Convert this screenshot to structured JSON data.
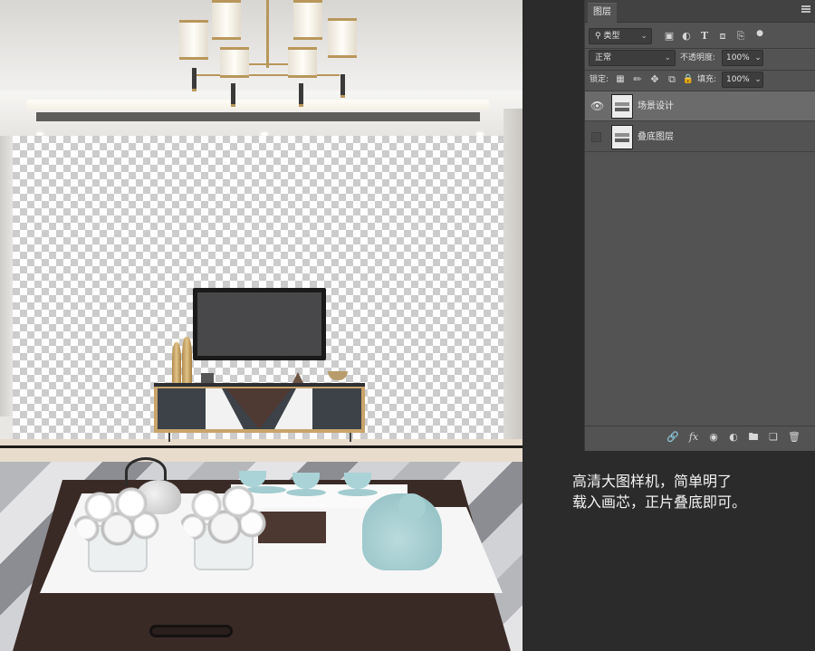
{
  "layers_panel": {
    "tab_title": "图层",
    "filter": {
      "label": "类型",
      "icon": "search-icon"
    },
    "filter_icons": [
      "image-filter-icon",
      "adjustment-filter-icon",
      "type-filter-icon",
      "shape-filter-icon",
      "smart-object-filter-icon",
      "filter-toggle-icon"
    ],
    "blend_mode": "正常",
    "opacity_label": "不透明度:",
    "opacity_value": "100%",
    "lock_label": "锁定:",
    "lock_icons": [
      "lock-transparent-icon",
      "lock-paint-icon",
      "lock-move-icon",
      "lock-artboard-icon",
      "lock-all-icon"
    ],
    "fill_label": "填充:",
    "fill_value": "100%",
    "layers": [
      {
        "name": "场景设计",
        "visible": true,
        "selected": true
      },
      {
        "name": "叠底图层",
        "visible": false,
        "selected": false
      }
    ],
    "footer_icons": [
      "link-icon",
      "fx-icon",
      "mask-icon",
      "adjustment-icon",
      "folder-icon",
      "new-layer-icon",
      "trash-icon"
    ],
    "fx_label": "fx"
  },
  "caption": {
    "line1": "高清大图样机，简单明了",
    "line2": "载入画芯，正片叠底即可。"
  },
  "colors": {
    "app_background": "#2b2b2b",
    "panel_background": "#535353",
    "selected_layer": "#6b6b6b",
    "caption_text": "#f3f3f3"
  }
}
